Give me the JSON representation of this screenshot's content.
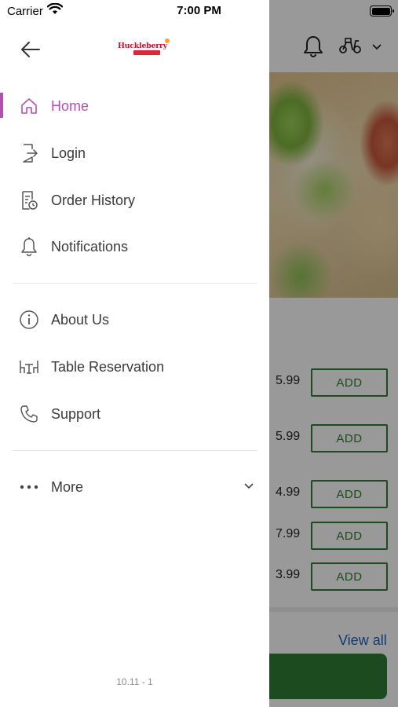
{
  "status_bar": {
    "carrier": "Carrier",
    "time": "7:00 PM"
  },
  "drawer": {
    "logo_text": "Huckleberry",
    "menu_primary": [
      {
        "label": "Home",
        "icon": "home-icon",
        "active": true
      },
      {
        "label": "Login",
        "icon": "login-icon",
        "active": false
      },
      {
        "label": "Order History",
        "icon": "order-history-icon",
        "active": false
      },
      {
        "label": "Notifications",
        "icon": "bell-icon",
        "active": false
      }
    ],
    "menu_secondary": [
      {
        "label": "About Us",
        "icon": "info-icon"
      },
      {
        "label": "Table Reservation",
        "icon": "table-icon"
      },
      {
        "label": "Support",
        "icon": "phone-icon"
      }
    ],
    "more": {
      "label": "More",
      "icon": "more-dots-icon"
    },
    "version": "10.11 - 1"
  },
  "background": {
    "items": [
      {
        "price": "5.99",
        "button": "ADD"
      },
      {
        "price": "5.99",
        "button": "ADD"
      },
      {
        "price": "4.99",
        "button": "ADD"
      },
      {
        "price": "7.99",
        "button": "ADD"
      },
      {
        "price": "3.99",
        "button": "ADD"
      }
    ],
    "view_all": "View all"
  },
  "colors": {
    "accent": "#b24fb1",
    "add_green": "#2e7d32",
    "link_blue": "#1f5fbf"
  }
}
